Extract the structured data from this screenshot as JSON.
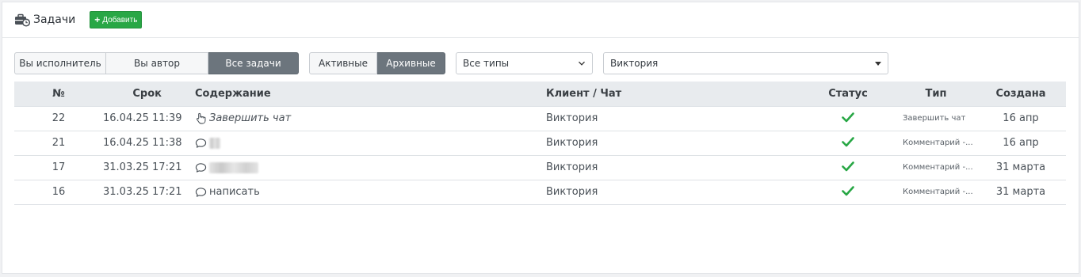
{
  "header": {
    "title": "Задачи",
    "add_button": "Добавить",
    "icon": "briefcase-clock-icon"
  },
  "filters": {
    "role_tabs": [
      "Вы исполнитель",
      "Вы автор",
      "Все задачи"
    ],
    "role_active": "Все задачи",
    "state_tabs": [
      "Активные",
      "Архивные"
    ],
    "state_active": "Архивные",
    "type_select": "Все типы",
    "client_select": "Виктория"
  },
  "table": {
    "columns": [
      "№",
      "Срок",
      "Содержание",
      "Клиент / Чат",
      "Статус",
      "Тип",
      "Создана"
    ],
    "rows": [
      {
        "num": "22",
        "due": "16.04.25 11:39",
        "content_icon": "hand-pointer-icon",
        "content": "Завершить чат",
        "client": "Виктория",
        "status": "done",
        "type": "Завершить чат",
        "created": "16 апр"
      },
      {
        "num": "21",
        "due": "16.04.25 11:38",
        "content_icon": "comment-icon",
        "content": "",
        "client": "Виктория",
        "status": "done",
        "type": "Комментарий -...",
        "created": "16 апр"
      },
      {
        "num": "17",
        "due": "31.03.25 17:21",
        "content_icon": "comment-icon",
        "content": "",
        "client": "Виктория",
        "status": "done",
        "type": "Комментарий -...",
        "created": "31 марта"
      },
      {
        "num": "16",
        "due": "31.03.25 17:21",
        "content_icon": "comment-icon",
        "content": "написать",
        "client": "Виктория",
        "status": "done",
        "type": "Комментарий -...",
        "created": "31 марта"
      }
    ]
  },
  "colors": {
    "add_button": "#28a745",
    "active_tab": "#6c757d",
    "status_check": "#28a745",
    "table_header": "#e8ebee"
  }
}
